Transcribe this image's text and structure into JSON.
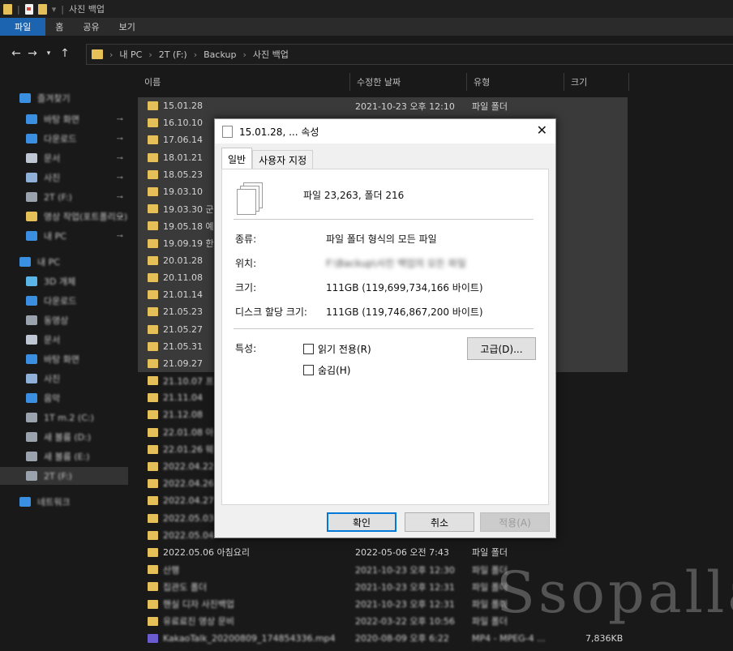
{
  "titlebar": {
    "title": "사진 백업"
  },
  "ribbon": {
    "tabs": [
      "파일",
      "홈",
      "공유",
      "보기"
    ]
  },
  "address": {
    "path": [
      "내 PC",
      "2T (F:)",
      "Backup",
      "사진 백업"
    ]
  },
  "nav": {
    "items": [
      {
        "label": "즐겨찾기",
        "icon": "star-icon",
        "pinned": false
      },
      {
        "label": "바탕 화면",
        "icon": "desktop-icon",
        "pinned": true
      },
      {
        "label": "다운로드",
        "icon": "download-icon",
        "pinned": true
      },
      {
        "label": "문서",
        "icon": "document-icon",
        "pinned": true
      },
      {
        "label": "사진",
        "icon": "pictures-icon",
        "pinned": true
      },
      {
        "label": "2T (F:)",
        "icon": "drive-icon",
        "pinned": true
      },
      {
        "label": "영상 작업(포트폴리오)",
        "icon": "folder-icon",
        "pinned": true
      },
      {
        "label": "내 PC",
        "icon": "pc-icon",
        "pinned": true
      },
      {
        "label": "내 PC",
        "icon": "pc-icon",
        "pinned": false
      },
      {
        "label": "3D 개체",
        "icon": "3d-objects-icon",
        "pinned": false
      },
      {
        "label": "다운로드",
        "icon": "download-icon",
        "pinned": false
      },
      {
        "label": "동영상",
        "icon": "video-icon",
        "pinned": false
      },
      {
        "label": "문서",
        "icon": "document-icon",
        "pinned": false
      },
      {
        "label": "바탕 화면",
        "icon": "desktop-icon",
        "pinned": false
      },
      {
        "label": "사진",
        "icon": "pictures-icon",
        "pinned": false
      },
      {
        "label": "음악",
        "icon": "music-icon",
        "pinned": false
      },
      {
        "label": "1T m.2 (C:)",
        "icon": "drive-icon",
        "pinned": false
      },
      {
        "label": "새 볼륨 (D:)",
        "icon": "drive-icon",
        "pinned": false
      },
      {
        "label": "새 볼륨 (E:)",
        "icon": "drive-icon",
        "pinned": false
      },
      {
        "label": "2T (F:)",
        "icon": "drive-icon",
        "pinned": false
      },
      {
        "label": "네트워크",
        "icon": "network-icon",
        "pinned": false
      }
    ]
  },
  "columns": [
    "이름",
    "수정한 날짜",
    "유형",
    "크기"
  ],
  "files": [
    {
      "name": "15.01.28",
      "date": "2021-10-23 오후 12:10",
      "type": "파일 폴더",
      "size": ""
    },
    {
      "name": "16.10.10",
      "date": "",
      "type": "",
      "size": ""
    },
    {
      "name": "17.06.14",
      "date": "",
      "type": "",
      "size": ""
    },
    {
      "name": "18.01.21",
      "date": "",
      "type": "",
      "size": ""
    },
    {
      "name": "18.05.23",
      "date": "",
      "type": "",
      "size": ""
    },
    {
      "name": "19.03.10",
      "date": "",
      "type": "",
      "size": ""
    },
    {
      "name": "19.03.30 군",
      "date": "",
      "type": "",
      "size": ""
    },
    {
      "name": "19.05.18 예",
      "date": "",
      "type": "",
      "size": ""
    },
    {
      "name": "19.09.19 한",
      "date": "",
      "type": "",
      "size": ""
    },
    {
      "name": "20.01.28",
      "date": "",
      "type": "",
      "size": ""
    },
    {
      "name": "20.11.08",
      "date": "",
      "type": "",
      "size": ""
    },
    {
      "name": "21.01.14",
      "date": "",
      "type": "",
      "size": ""
    },
    {
      "name": "21.05.23",
      "date": "",
      "type": "",
      "size": ""
    },
    {
      "name": "21.05.27",
      "date": "",
      "type": "",
      "size": ""
    },
    {
      "name": "21.05.31",
      "date": "",
      "type": "",
      "size": ""
    },
    {
      "name": "21.09.27",
      "date": "",
      "type": "",
      "size": ""
    },
    {
      "name": "21.10.07 프",
      "date": "",
      "type": "",
      "size": ""
    },
    {
      "name": "21.11.04",
      "date": "",
      "type": "",
      "size": ""
    },
    {
      "name": "21.12.08",
      "date": "",
      "type": "",
      "size": ""
    },
    {
      "name": "22.01.08 아",
      "date": "",
      "type": "",
      "size": ""
    },
    {
      "name": "22.01.26 웨",
      "date": "",
      "type": "",
      "size": ""
    },
    {
      "name": "2022.04.22",
      "date": "",
      "type": "",
      "size": ""
    },
    {
      "name": "2022.04.26",
      "date": "",
      "type": "",
      "size": ""
    },
    {
      "name": "2022.04.27",
      "date": "",
      "type": "",
      "size": ""
    },
    {
      "name": "2022.05.03",
      "date": "",
      "type": "",
      "size": ""
    },
    {
      "name": "2022.05.04",
      "date": "",
      "type": "",
      "size": ""
    },
    {
      "name": "2022.05.06 아침요리",
      "date": "2022-05-06 오전 7:43",
      "type": "파일 폴더",
      "size": ""
    },
    {
      "name": "산행",
      "date": "2021-10-23 오후 12:30",
      "type": "파일 폴더",
      "size": ""
    },
    {
      "name": "집관도 폴더",
      "date": "2021-10-23 오후 12:31",
      "type": "파일 폴더",
      "size": ""
    },
    {
      "name": "핸실 디자 사진백업",
      "date": "2021-10-23 오후 12:31",
      "type": "파일 폴더",
      "size": ""
    },
    {
      "name": "유료료진 영상 문비",
      "date": "2022-03-22 오후 10:56",
      "type": "파일 폴더",
      "size": ""
    },
    {
      "name": "KakaoTalk_20200809_174854336.mp4",
      "date": "2020-08-09 오후 6:22",
      "type": "MP4 - MPEG-4 ...",
      "size": "7,836KB"
    }
  ],
  "watermark": "Ssopalla",
  "dialog": {
    "title": "15.01.28, ... 속성",
    "tabs": [
      "일반",
      "사용자 지정"
    ],
    "summary": "파일 23,263, 폴더 216",
    "rows": [
      {
        "label": "종류:",
        "value": "파일 폴더 형식의 모든 파일"
      },
      {
        "label": "위치:",
        "value": "F:\\Backup\\사진 백업의 모든 파일"
      },
      {
        "label": "크기:",
        "value": "111GB (119,699,734,166 바이트)"
      },
      {
        "label": "디스크 할당 크기:",
        "value": "111GB (119,746,867,200 바이트)"
      }
    ],
    "attributes_label": "특성:",
    "readonly_label": "읽기 전용(R)",
    "hidden_label": "숨김(H)",
    "advanced_label": "고급(D)...",
    "ok_label": "확인",
    "cancel_label": "취소",
    "apply_label": "적용(A)"
  },
  "colors": {
    "accent": "#1c63b0",
    "folder": "#e5bf57",
    "dialog_bg": "#f0f0f0"
  }
}
